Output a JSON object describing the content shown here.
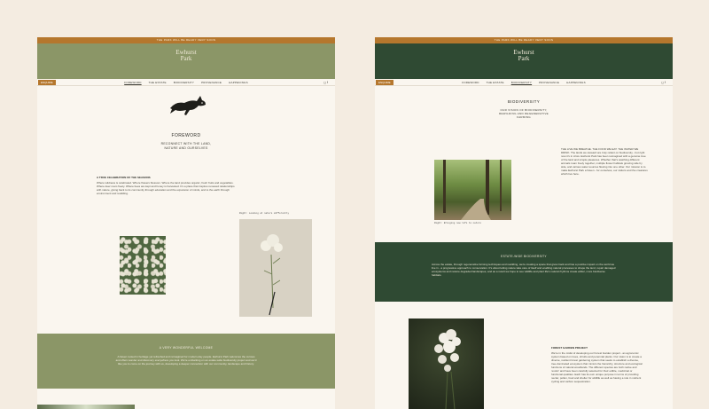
{
  "left_page": {
    "topbar": "THE PARK WILL BE READY VERY SOON",
    "logo_line1": "Ewhurst",
    "logo_line2": "Park",
    "enquire": "ENQUIRE",
    "nav": [
      "FOREWORD",
      "THE ESTATE",
      "BIODIVERSITY",
      "PROVENANCE",
      "HAPPENINGS"
    ],
    "social": [
      "◻",
      "f"
    ],
    "title": "FOREWORD",
    "subtitle_line1": "RECONNECT WITH THE LAND,",
    "subtitle_line2": "NATURE AND OURSELVES",
    "section_heading": "A TRUE CELEBRATION OF THE SEASONS",
    "body": "Where wildness is celebrated. Where flowers blossom. Where the land provides organic, fresh fruits and vegetables. Where deer roam freely. Where bees are kept and honey is harvested. It's a place that inspires renewed relationships with nature, giving back to its community through education and the expansion of minds, and to the earth through environment and rewilding.",
    "caption": "Right: Looking at nature differently",
    "band_heading": "A VERY WONDERFUL WELCOME",
    "band_text": "A haven rooted in heritage yet refreshed and reimagined for modern-day people. Ewhurst Park welcomes the curious and offers wonder and discovery everywhere you look. We're embarking on an estate-wide biodiversity project and we'd like you to come on the journey with us, developing a deeper connection with our community, landscape and history."
  },
  "right_page": {
    "topbar": "THE PARK WILL BE READY VERY SOON",
    "logo_line1": "Ewhurst",
    "logo_line2": "Park",
    "enquire": "ENQUIRE",
    "nav": [
      "FOREWORD",
      "THE ESTATE",
      "BIODIVERSITY",
      "PROVENANCE",
      "HAPPENINGS"
    ],
    "social": [
      "◻",
      "f"
    ],
    "title": "BIODIVERSITY",
    "subtitle_line1": "OUR VISION OF BIODIVERSITY,",
    "subtitle_line2": "REWILDING AND REGENERATIVE",
    "subtitle_line3": "FARMING",
    "intro": "THE LIVE WE BREATHE. THE FOOD WE EAT. THE WATER WE DRINK. The lands we steward are truly reliant on biodiversity - but right now it's in crisis. Ewhurst Park has been reimagined with a genuine love of the land and simple pleasures. Whether that's watching different animals roam freely together, multiple flower habitats growing side by side, and various water sources flowing into one other. Our mission is to make Ewhurst Park a haven - for ourselves, our visitors and the creatures which live here.",
    "caption": "Right: Bringing new life to nature",
    "band_heading": "ESTATE-WIDE BIODIVERSITY",
    "band_text": "Across the estate, through regenerative farming techniques and rewilding, we're creating a space that gives back and has a positive impact on the world we live in - a progressive approach to conservation. It's about letting nature take care of itself and enabling natural processes to shape the land, repair damaged ecosystems and restore degraded landscapes, and as a result we hope to see wildlife and plant life's natural rhythms create wilder, more biodiverse habitats.",
    "project_heading": "FOREST GARDEN PROJECT",
    "project_text": "We're in the midst of developing our Forest Garden project - an agronomic system based on trees, shrubs and perennial plants. Our vision is to create a diverse, resilient forest gardening system that seeks to establish a diverse, tree-dominated ecosystem that mimics the hierarchy, structure and ecological functions of natural woodlands. The different species are both native and 'exotic' and have been carefully selected for their edible, medicinal or functional qualities. Each has its own unique purpose in terms of providing nectar, pollen, food and shelter for wildlife as well as having a role in nutrient cycling and carbon sequestration."
  }
}
